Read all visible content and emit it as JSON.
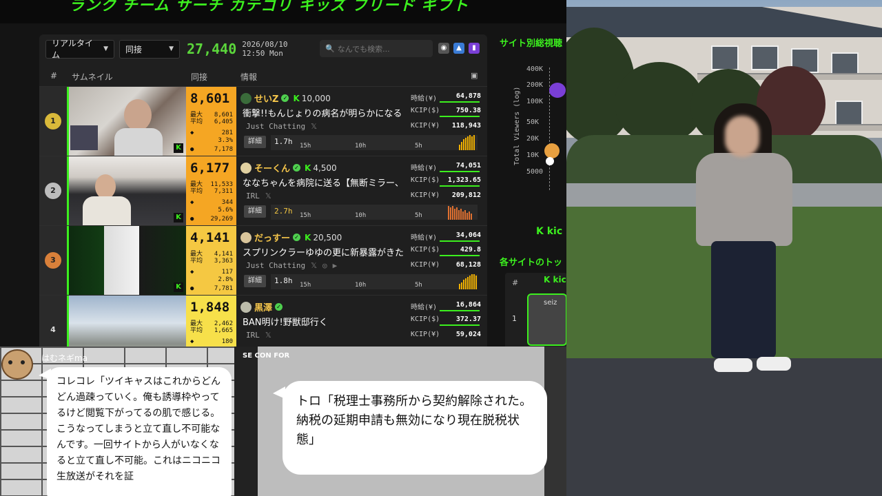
{
  "banner": {
    "text": "ランク チーム サーチ カテゴリ キッズ フリード ギフト"
  },
  "controls": {
    "mode": "リアルタイム",
    "metric": "同接",
    "total_viewers": "27,440",
    "date": "2026/08/10",
    "time": "12:50 Mon",
    "search_placeholder": "なんでも検索..."
  },
  "table_header": {
    "rank": "#",
    "thumbnail": "サムネイル",
    "viewers": "同接",
    "info": "情報"
  },
  "labels": {
    "max": "最大",
    "avg": "平均",
    "detail": "詳細",
    "hourly": "時給(¥)",
    "kcip_usd": "KCIP($)",
    "kcip_jpy": "KCIP(¥)",
    "k": "K",
    "t15": "15h",
    "t10": "10h",
    "t5": "5h"
  },
  "rows": [
    {
      "rank": "1",
      "viewers": "8,601",
      "max": "8,601",
      "avg": "6,405",
      "s1": "281",
      "s2": "3.3%",
      "s3": "7,178",
      "name": "せいZ",
      "followers": "10,000",
      "title": "衝撃!!もんじょりの病名が明らかになる",
      "category": "Just Chatting",
      "duration": "1.7h",
      "hourly": "64,878",
      "kcip_usd": "750.38",
      "kcip_jpy": "118,943",
      "color": "#f5a623"
    },
    {
      "rank": "2",
      "viewers": "6,177",
      "max": "11,533",
      "avg": "7,311",
      "s1": "344",
      "s2": "5.6%",
      "s3": "29,269",
      "name": "そーくん",
      "followers": "4,500",
      "title": "ななちゃんを病院に送る【無断ミラー、",
      "category": "IRL",
      "duration": "2.7h",
      "hourly": "74,051",
      "kcip_usd": "1,323.65",
      "kcip_jpy": "209,812",
      "color": "#f5a623"
    },
    {
      "rank": "3",
      "viewers": "4,141",
      "max": "4,141",
      "avg": "3,363",
      "s1": "117",
      "s2": "2.8%",
      "s3": "7,781",
      "name": "だっすー",
      "followers": "20,500",
      "title": "スプリンクラーゆゆの更に新暴露がきた",
      "category": "Just Chatting",
      "duration": "1.8h",
      "hourly": "34,064",
      "kcip_usd": "429.8",
      "kcip_jpy": "68,128",
      "color": "#f5c842"
    },
    {
      "rank": "4",
      "viewers": "1,848",
      "max": "2,462",
      "avg": "1,665",
      "s1": "180",
      "s2": "",
      "s3": "",
      "name": "黒澤",
      "followers": "",
      "title": "BAN明け!野獣邸行く",
      "category": "IRL",
      "duration": "",
      "hourly": "16,864",
      "kcip_usd": "372.37",
      "kcip_jpy": "59,024",
      "color": "#f7e04a"
    }
  ],
  "sidebar": {
    "site_views_header": "サイト別総視聴",
    "y_axis_title": "Total Viewers (log)",
    "y_ticks": [
      "400K",
      "200K",
      "100K",
      "50K",
      "20K",
      "10K",
      "5000"
    ],
    "kick": "kic",
    "top_header": "各サイトのトッ",
    "top_rank_col": "#",
    "top_rank_1": "1",
    "top_name": "seiz"
  },
  "manga": {
    "author": "はむネギma",
    "bubble1": "コレコレ「ツイキャスはこれからどんどん過疎っていく。俺も誘導枠やってるけど閲覧下がってるの肌で感じる。こうなってしまうと立て直し不可能なんです。一回サイトから人がいなくなると立て直し不可能。これはニコニコ生放送がそれを証",
    "bubble2": "トロ「税理士事務所から契約解除された。納税の延期申請も無効になり現在脱税状態」",
    "corner_label": "SE CON FOR"
  }
}
